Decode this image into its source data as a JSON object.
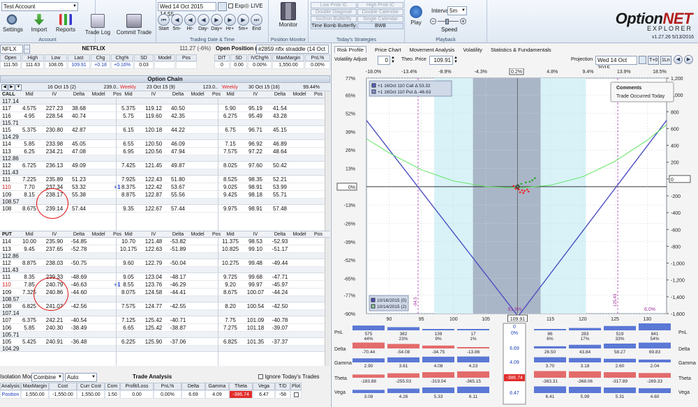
{
  "ribbon": {
    "account_combo": "Test Account",
    "buttons": {
      "settings": "Settings",
      "import": "Import",
      "reports": "Reports",
      "trade_log": "Trade Log",
      "commit_trade": "Commit Trade",
      "monitor": "Monitor",
      "play": "Play"
    },
    "groups": {
      "account": "Account",
      "trading_date": "Trading Date & Time",
      "position_monitor": "Position Monitor",
      "strategies": "Today's Strategies",
      "playback": "Playback"
    },
    "date_value": "Wed 14 Oct 2015 14:55",
    "exp_label": "Exp",
    "live_label": "LIVE",
    "nav": [
      "Start",
      "5m-",
      "Hr-",
      "Day-",
      "Day+",
      "Hr+",
      "5m+",
      "End"
    ],
    "strategies": [
      "Low Prob IC",
      "High Prob IC",
      "Double Diagonal",
      "Double Calendar",
      "Inc/Iron Butterfly",
      "Single Calendar",
      "Time Bomb Butterfly",
      "BWB"
    ],
    "interval_label": "Interval",
    "interval_value": "5m",
    "speed_label": "Speed",
    "logo_a": "Option",
    "logo_b": "NET",
    "logo_sub": "EXPLORER",
    "version": "v1.27.26  5/13/2016"
  },
  "quote": {
    "symbol": "NFLX",
    "name": "NETFLIX",
    "price_change": "111.27 (-6%)",
    "headers": [
      "Open",
      "High",
      "Low",
      "Last",
      "Chg",
      "Chg%",
      "SD",
      "Model",
      "Pos"
    ],
    "values": [
      "111.50",
      "111.63",
      "108.05",
      "109.91",
      "+0.18",
      "+0.16%",
      "0.03",
      "",
      ""
    ]
  },
  "position": {
    "title": "Open Position (4)",
    "combo": "#2859 nflx straddle (14 Oct",
    "headers": [
      "DIT",
      "SD",
      "IVChg%",
      "MaxMargin",
      "PnL%"
    ],
    "values": [
      "0",
      "0.00",
      "0.00%",
      "1,550.00",
      "0.00%"
    ]
  },
  "chain": {
    "title": "Option Chain",
    "expiries": [
      "16 Oct 15 (2)",
      "23 Oct 15 (9)",
      "30 Oct 15 (16)"
    ],
    "expiry_extras": [
      "239.0..",
      "123.0..",
      "99.44%"
    ],
    "weekly": "Weekly",
    "col_headers": [
      "Mid",
      "IV",
      "Delta",
      "Model",
      "Pos"
    ],
    "call_label": "CALL",
    "put_label": "PUT",
    "calls": [
      {
        "strike": "117.14",
        "sep": true
      },
      {
        "strike": "117",
        "a": [
          "4.575",
          "227.23",
          "38.68",
          "",
          ""
        ],
        "b": [
          "5.375",
          "119.12",
          "40.50",
          "",
          ""
        ],
        "c": [
          "5.90",
          "95.19",
          "41.54",
          "",
          ""
        ]
      },
      {
        "strike": "116",
        "a": [
          "4.95",
          "228.54",
          "40.74",
          "",
          ""
        ],
        "b": [
          "5.75",
          "119.60",
          "42.35",
          "",
          ""
        ],
        "c": [
          "6.275",
          "95.49",
          "43.28",
          "",
          ""
        ]
      },
      {
        "strike": "115.71",
        "sep": true
      },
      {
        "strike": "115",
        "a": [
          "5.375",
          "230.80",
          "42.87",
          "",
          ""
        ],
        "b": [
          "6.15",
          "120.18",
          "44.22",
          "",
          ""
        ],
        "c": [
          "6.75",
          "96.71",
          "45.15",
          "",
          ""
        ]
      },
      {
        "strike": "114.29",
        "sep": true
      },
      {
        "strike": "114",
        "a": [
          "5.85",
          "233.98",
          "45.05",
          "",
          ""
        ],
        "b": [
          "6.55",
          "120.50",
          "46.09",
          "",
          ""
        ],
        "c": [
          "7.15",
          "96.92",
          "46.89",
          "",
          ""
        ]
      },
      {
        "strike": "113",
        "a": [
          "6.25",
          "234.21",
          "47.08",
          "",
          ""
        ],
        "b": [
          "6.95",
          "120.56",
          "47.94",
          "",
          ""
        ],
        "c": [
          "7.575",
          "97.22",
          "48.64",
          "",
          ""
        ]
      },
      {
        "strike": "112.86",
        "sep": true
      },
      {
        "strike": "112",
        "a": [
          "6.725",
          "236.13",
          "49.09",
          "",
          ""
        ],
        "b": [
          "7.425",
          "121.45",
          "49.87",
          "",
          ""
        ],
        "c": [
          "8.025",
          "97.60",
          "50.42",
          "",
          ""
        ]
      },
      {
        "strike": "111.43",
        "sep": true
      },
      {
        "strike": "111",
        "a": [
          "7.225",
          "235.89",
          "51.23",
          "",
          ""
        ],
        "b": [
          "7.925",
          "122.43",
          "51.80",
          "",
          ""
        ],
        "c": [
          "8.525",
          "98.35",
          "52.21",
          "",
          ""
        ]
      },
      {
        "strike": "110",
        "red": true,
        "a": [
          "7.70",
          "237.34",
          "53.32",
          "",
          "+1"
        ],
        "b": [
          "8.375",
          "122.42",
          "53.67",
          "",
          ""
        ],
        "c": [
          "9.025",
          "98.91",
          "53.99",
          "",
          ""
        ]
      },
      {
        "strike": "109",
        "a": [
          "8.15",
          "238.17",
          "55.38",
          "",
          ""
        ],
        "b": [
          "8.875",
          "122.87",
          "55.56",
          "",
          ""
        ],
        "c": [
          "9.425",
          "98.18",
          "55.71",
          "",
          ""
        ]
      },
      {
        "strike": "108.57",
        "sep": true
      },
      {
        "strike": "108",
        "a": [
          "8.675",
          "239.14",
          "57.44",
          "",
          ""
        ],
        "b": [
          "9.35",
          "122.67",
          "57.44",
          "",
          ""
        ],
        "c": [
          "9.975",
          "98.91",
          "57.48",
          "",
          ""
        ]
      }
    ],
    "puts": [
      {
        "strike": "114",
        "a": [
          "10.00",
          "235.90",
          "-54.85",
          "",
          ""
        ],
        "b": [
          "10.70",
          "121.48",
          "-53.82",
          "",
          ""
        ],
        "c": [
          "11.375",
          "98.53",
          "-52.93",
          "",
          ""
        ]
      },
      {
        "strike": "113",
        "a": [
          "9.45",
          "237.65",
          "-52.78",
          "",
          ""
        ],
        "b": [
          "10.175",
          "122.63",
          "-51.89",
          "",
          ""
        ],
        "c": [
          "10.825",
          "99.10",
          "-51.17",
          "",
          ""
        ]
      },
      {
        "strike": "112.86",
        "sep": true
      },
      {
        "strike": "112",
        "a": [
          "8.875",
          "238.03",
          "-50.75",
          "",
          ""
        ],
        "b": [
          "9.60",
          "122.79",
          "-50.04",
          "",
          ""
        ],
        "c": [
          "10.275",
          "99.48",
          "-49.44",
          "",
          ""
        ]
      },
      {
        "strike": "111.43",
        "sep": true
      },
      {
        "strike": "111",
        "a": [
          "8.35",
          "239.33",
          "-48.69",
          "",
          ""
        ],
        "b": [
          "9.05",
          "123.04",
          "-48.17",
          "",
          ""
        ],
        "c": [
          "9.725",
          "99.68",
          "-47.71",
          "",
          ""
        ]
      },
      {
        "strike": "110",
        "red": true,
        "a": [
          "7.85",
          "240.79",
          "-46.63",
          "",
          "+1"
        ],
        "b": [
          "8.55",
          "123.76",
          "-46.29",
          "",
          ""
        ],
        "c": [
          "9.20",
          "99.97",
          "-45.97",
          "",
          ""
        ]
      },
      {
        "strike": "109",
        "a": [
          "7.325",
          "240.86",
          "-44.60",
          "",
          ""
        ],
        "b": [
          "8.075",
          "124.58",
          "-44.41",
          "",
          ""
        ],
        "c": [
          "8.675",
          "100.07",
          "-44.24",
          "",
          ""
        ]
      },
      {
        "strike": "108.57",
        "sep": true
      },
      {
        "strike": "108",
        "a": [
          "6.825",
          "241.07",
          "-42.56",
          "",
          ""
        ],
        "b": [
          "7.575",
          "124.77",
          "-42.55",
          "",
          ""
        ],
        "c": [
          "8.20",
          "100.54",
          "-42.50",
          "",
          ""
        ]
      },
      {
        "strike": "107.14",
        "sep": true
      },
      {
        "strike": "107",
        "a": [
          "6.375",
          "242.21",
          "-40.54",
          "",
          ""
        ],
        "b": [
          "7.125",
          "125.42",
          "-40.71",
          "",
          ""
        ],
        "c": [
          "7.75",
          "101.09",
          "-40.78",
          "",
          ""
        ]
      },
      {
        "strike": "106",
        "a": [
          "5.85",
          "240.30",
          "-38.49",
          "",
          ""
        ],
        "b": [
          "6.65",
          "125.42",
          "-38.87",
          "",
          ""
        ],
        "c": [
          "7.275",
          "101.18",
          "-39.07",
          "",
          ""
        ]
      },
      {
        "strike": "105.71",
        "sep": true
      },
      {
        "strike": "105",
        "a": [
          "5.425",
          "240.91",
          "-36.48",
          "",
          ""
        ],
        "b": [
          "6.225",
          "125.90",
          "-37.06",
          "",
          ""
        ],
        "c": [
          "6.825",
          "101.35",
          "-37.37",
          "",
          ""
        ]
      },
      {
        "strike": "104.29",
        "sep": true
      }
    ]
  },
  "trade": {
    "title": "Trade Analysis",
    "isolation_label": "Isolation Mode",
    "isolation_value": "Combine",
    "auto_value": "Auto",
    "ignore_label": "Ignore Today's Trades",
    "headers": [
      "Analysis",
      "MaxMargin",
      "Cost",
      "Curr Cost",
      "Com",
      "Profit/Loss",
      "PnL%",
      "Delta",
      "Gamma",
      "Theta",
      "Vega",
      "T/D",
      "Plot"
    ],
    "values": [
      "Position",
      "1,550.00",
      "-1,550.00",
      "1,550.00",
      "1.50",
      "0.00",
      "0.00%",
      "6.69",
      "4.09",
      "-386.74",
      "6.47",
      "-58",
      ""
    ]
  },
  "right": {
    "tabs": [
      "Risk Profile",
      "Price Chart",
      "Movement Analysis",
      "Volatility",
      "Statistics & Fundamentals"
    ],
    "vol_adjust_label": "Volatility Adjust",
    "vol_adjust_value": "0",
    "theo_label": "Theo. Price",
    "theo_value": "109.91",
    "projection_label": "Projection",
    "projection_value": "Wed 14 Oct 2015",
    "t0_label": "T+0",
    "one_label": "1Ln",
    "pct_ticks": [
      "-18.0%",
      "-13.4%",
      "-8.9%",
      "-4.3%",
      "0.2%",
      "4.8%",
      "9.4%",
      "13.9%",
      "18.5%"
    ],
    "comments_title": "Comments",
    "comments_text": "Trade Occurred Today",
    "legend": [
      "+1 16Oct 110 Call Δ   53.32",
      "+1 16Oct 110 Put Δ   -46.63"
    ],
    "date_legend": [
      "10/16/2015 (0)",
      "10/14/2015 (2)"
    ],
    "pct_label_left": "91.9%",
    "pct_label_right": "6.0%",
    "price_label": "109.91",
    "cursor_label_left": "-94.5",
    "cursor_label_right": "125.43"
  },
  "chart_data": {
    "type": "line",
    "x_ticks": [
      90,
      95,
      100,
      105,
      110,
      115,
      120,
      125,
      130
    ],
    "xlim": [
      86.5,
      133
    ],
    "left_axis": [
      "77%",
      "65%",
      "52%",
      "39%",
      "26%",
      "13%",
      "0%",
      "-13%",
      "-26%",
      "-39%",
      "-52%",
      "-65%",
      "-77%",
      "-90%"
    ],
    "left_ylim": [
      -90,
      77
    ],
    "right_axis": [
      "1,200",
      "1,000",
      "800",
      "600",
      "400",
      "200",
      "0",
      "-200",
      "-400",
      "-600",
      "-800",
      "-1,000",
      "-1,200",
      "-1,400",
      "-1,600"
    ],
    "right_ylim": [
      -1600,
      1200
    ],
    "series": [
      {
        "name": "expiry",
        "color": "#4d4ec2",
        "points": [
          [
            86.5,
            47
          ],
          [
            110,
            -91.9
          ],
          [
            133,
            47
          ]
        ]
      },
      {
        "name": "t0",
        "color": "#5ee65e",
        "points": [
          [
            86.5,
            34
          ],
          [
            90,
            24
          ],
          [
            95,
            12
          ],
          [
            100,
            4
          ],
          [
            105,
            0
          ],
          [
            110,
            -1
          ],
          [
            115,
            1
          ],
          [
            120,
            7
          ],
          [
            125,
            18
          ],
          [
            130,
            33
          ],
          [
            133,
            44
          ]
        ]
      }
    ],
    "vlines": [
      94.5,
      125.43
    ]
  },
  "greeks": {
    "rows": [
      "PnL",
      "Delta",
      "Gamma",
      "Theta",
      "Vega"
    ],
    "center": [
      "0",
      "0%",
      "6.69",
      "4.09",
      "-386.74",
      "6.47"
    ],
    "pnl_left": [
      [
        "575",
        "44%"
      ],
      [
        "382",
        "23%"
      ],
      [
        "139",
        "9%"
      ],
      [
        "17",
        "1%"
      ]
    ],
    "pnl_right": [
      [
        "86",
        "6%"
      ],
      [
        "283",
        "17%"
      ],
      [
        "519",
        "33%"
      ],
      [
        "841",
        "54%"
      ]
    ],
    "delta_left": [
      "-70.44",
      "-54.08",
      "-34.75",
      "-13.86"
    ],
    "delta_right": [
      "26.50",
      "43.84",
      "58.27",
      "69.83"
    ],
    "gamma_left": [
      "2.90",
      "3.61",
      "4.08",
      "4.23"
    ],
    "gamma_right": [
      "3.70",
      "3.18",
      "2.60",
      "2.04"
    ],
    "theta_left": [
      "-183.88",
      "-255.03",
      "-319.04",
      "-365.15"
    ],
    "theta_right": [
      "-383.31",
      "-368.06",
      "-317.89",
      "-269.33"
    ],
    "vega_left": [
      "3.08",
      "4.26",
      "5.33",
      "6.11"
    ],
    "vega_right": [
      "6.41",
      "5.99",
      "5.31",
      "4.60"
    ]
  }
}
